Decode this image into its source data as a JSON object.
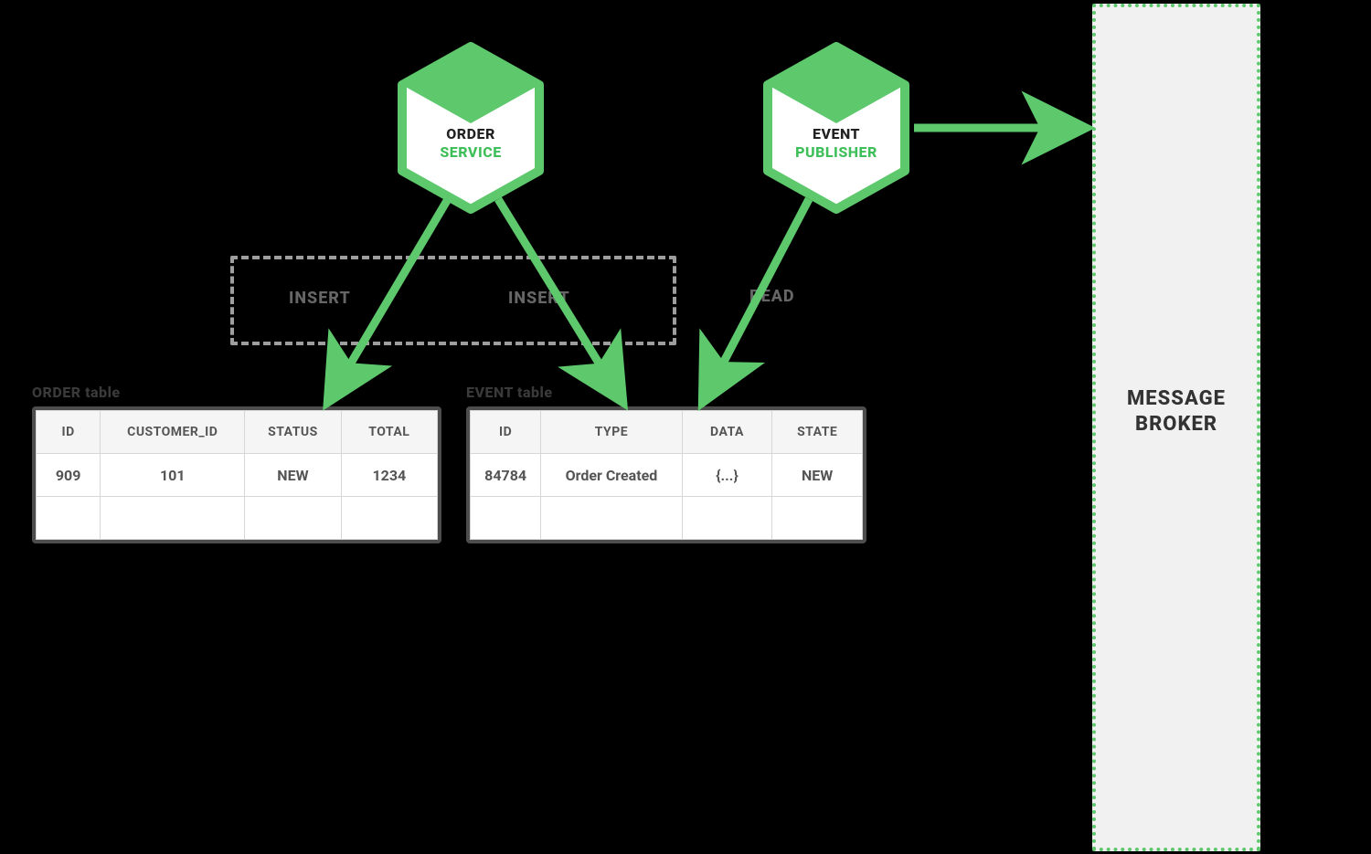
{
  "hexes": {
    "order_service": {
      "top_label": "ORDER",
      "bottom_label": "SERVICE"
    },
    "event_publisher": {
      "top_label": "EVENT",
      "bottom_label": "PUBLISHER"
    }
  },
  "transaction_box": {
    "step1": "INSERT",
    "step2": "INSERT"
  },
  "read_label": "READ",
  "order_table": {
    "caption": "ORDER table",
    "headers": [
      "ID",
      "CUSTOMER_ID",
      "STATUS",
      "TOTAL"
    ],
    "row": {
      "id": "909",
      "customer_id": "101",
      "status": "NEW",
      "total": "1234"
    }
  },
  "event_table": {
    "caption": "EVENT table",
    "headers": [
      "ID",
      "TYPE",
      "DATA",
      "STATE"
    ],
    "row": {
      "id": "84784",
      "type": "Order Created",
      "data": "{...}",
      "state": "NEW"
    }
  },
  "broker": {
    "title_line1": "MESSAGE",
    "title_line2": "BROKER"
  },
  "colors": {
    "green": "#5ec86d",
    "green_dark": "#3fbf5a",
    "grey_border": "#4d4d4d"
  }
}
